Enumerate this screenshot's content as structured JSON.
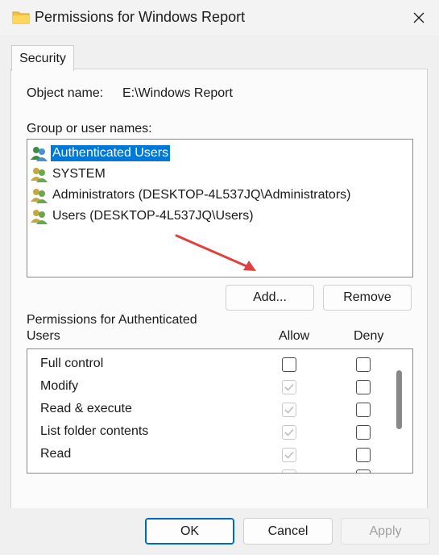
{
  "window": {
    "title": "Permissions for Windows Report"
  },
  "tabs": [
    {
      "label": "Security"
    }
  ],
  "object": {
    "label": "Object name:",
    "value": "E:\\Windows Report"
  },
  "group_label": "Group or user names:",
  "users": [
    {
      "name": "Authenticated Users",
      "selected": true
    },
    {
      "name": "SYSTEM",
      "selected": false
    },
    {
      "name": "Administrators (DESKTOP-4L537JQ\\Administrators)",
      "selected": false
    },
    {
      "name": "Users (DESKTOP-4L537JQ\\Users)",
      "selected": false
    }
  ],
  "buttons": {
    "add": "Add...",
    "remove": "Remove",
    "ok": "OK",
    "cancel": "Cancel",
    "apply": "Apply"
  },
  "permissions": {
    "title_line1": "Permissions for Authenticated",
    "title_line2": "Users",
    "allow_label": "Allow",
    "deny_label": "Deny",
    "rows": [
      {
        "name": "Full control",
        "allow": false,
        "allow_disabled": false,
        "deny": false
      },
      {
        "name": "Modify",
        "allow": true,
        "allow_disabled": true,
        "deny": false
      },
      {
        "name": "Read & execute",
        "allow": true,
        "allow_disabled": true,
        "deny": false
      },
      {
        "name": "List folder contents",
        "allow": true,
        "allow_disabled": true,
        "deny": false
      },
      {
        "name": "Read",
        "allow": true,
        "allow_disabled": true,
        "deny": false
      }
    ]
  },
  "colors": {
    "selection": "#0078d7",
    "annotation_arrow": "#e04040"
  }
}
